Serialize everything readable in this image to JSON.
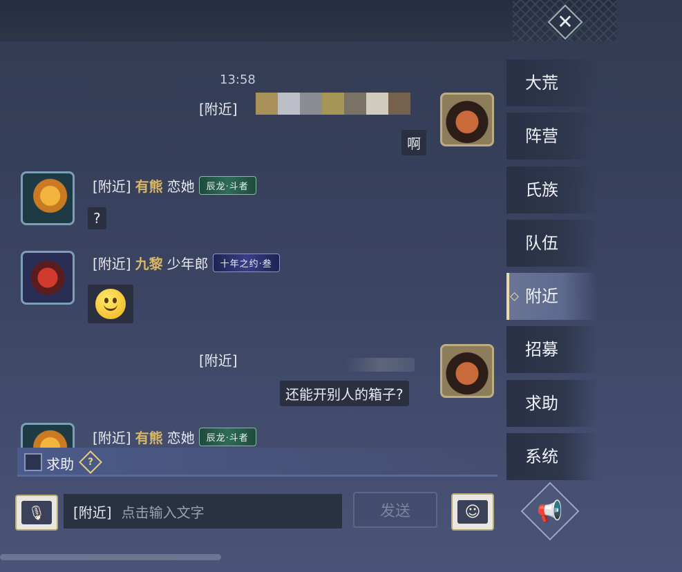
{
  "close_icon": "x-diamond-icon",
  "chat": {
    "time": "13:58",
    "channel_label": "[附近]",
    "messages": [
      {
        "side": "right",
        "bubble": "啊"
      },
      {
        "side": "left",
        "guild": "有熊",
        "name": "恋她",
        "badge": "辰龙·斗者",
        "bubble": "?"
      },
      {
        "side": "left",
        "guild": "九黎",
        "name": "少年郎",
        "badge": "十年之约·叁",
        "emoji": "smiley-icon"
      },
      {
        "side": "right",
        "bubble": "还能开别人的箱子?"
      },
      {
        "side": "left",
        "guild": "有熊",
        "name": "恋她",
        "badge": "辰龙·斗者"
      }
    ],
    "mosaic_colors": [
      "#a89159",
      "#bcbfc7",
      "#8b8d93",
      "#a79457",
      "#7a7264",
      "#d2cbc0",
      "#76624c"
    ]
  },
  "help": {
    "label": "求助",
    "checked": false
  },
  "tabs": [
    {
      "label": "大荒",
      "active": false
    },
    {
      "label": "阵营",
      "active": false
    },
    {
      "label": "氏族",
      "active": false
    },
    {
      "label": "队伍",
      "active": false
    },
    {
      "label": "附近",
      "active": true
    },
    {
      "label": "招募",
      "active": false
    },
    {
      "label": "求助",
      "active": false
    },
    {
      "label": "系统",
      "active": false
    }
  ],
  "input": {
    "prefix": "[附近]",
    "placeholder": "点击输入文字"
  },
  "send_label": "发送",
  "accent_gold": "#d9b767"
}
